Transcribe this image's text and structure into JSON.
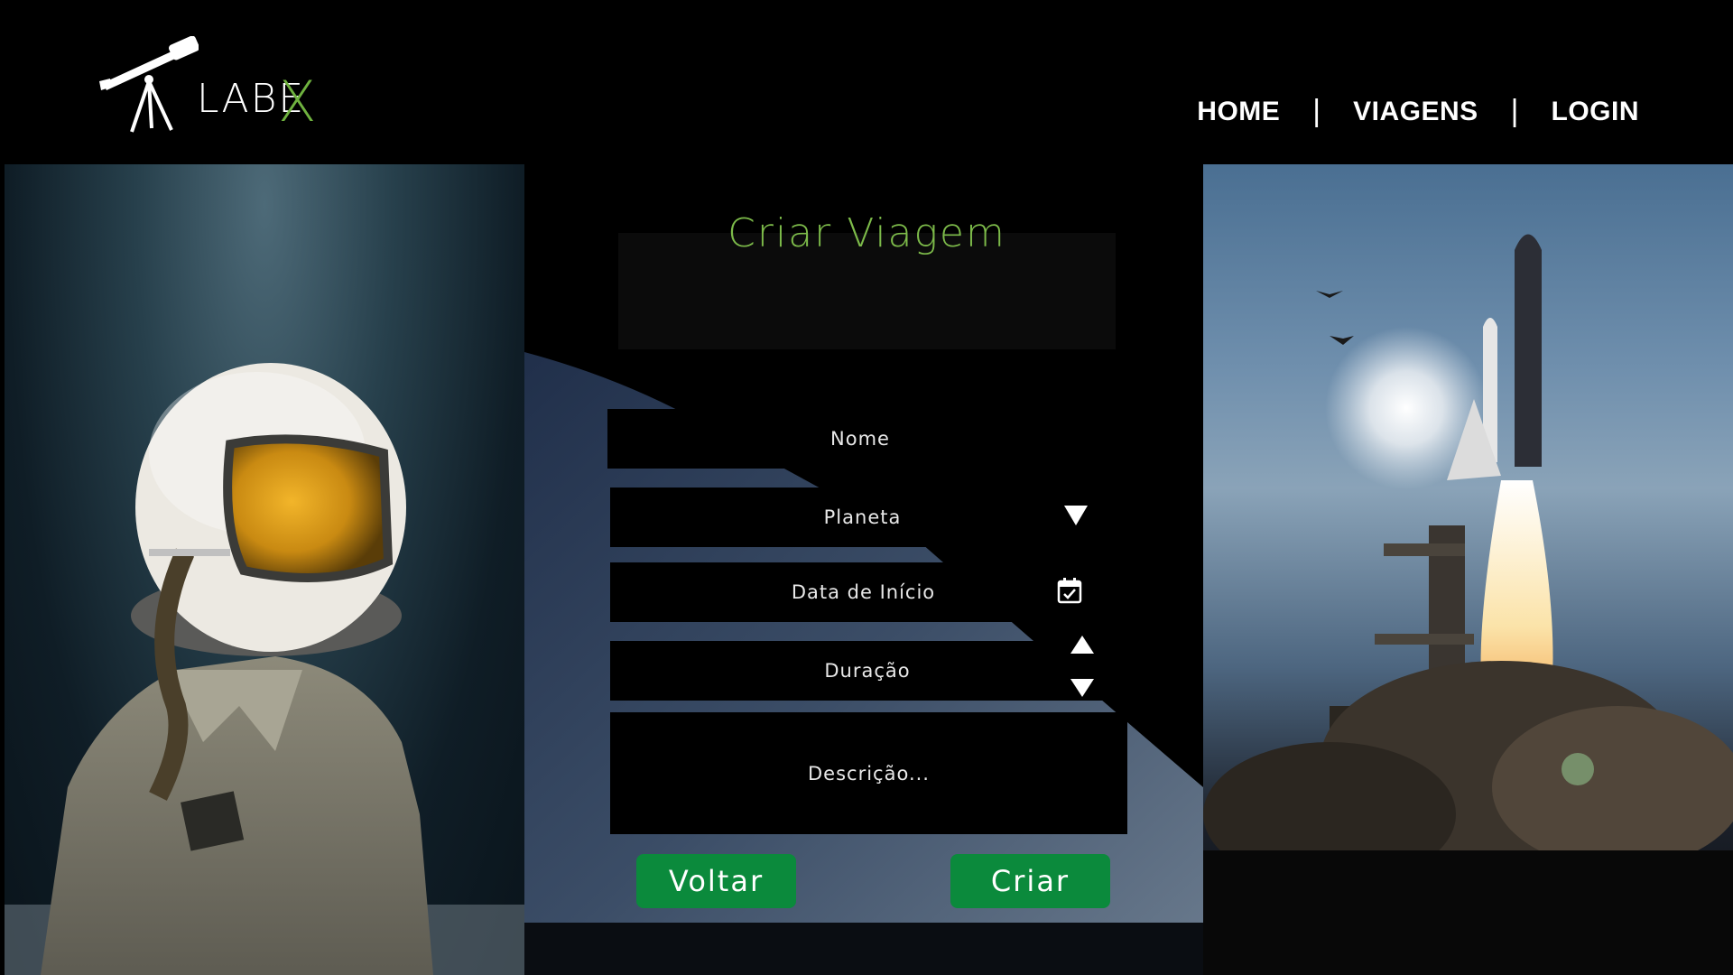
{
  "header": {
    "logo_text": "LABE",
    "logo_accent": "X",
    "nav": [
      {
        "label": "HOME"
      },
      {
        "label": "VIAGENS"
      },
      {
        "label": "LOGIN"
      }
    ],
    "separator": "|"
  },
  "form": {
    "title": "Criar Viagem",
    "fields": {
      "name_placeholder": "Nome",
      "planet_placeholder": "Planeta",
      "start_date_placeholder": "Data de Início",
      "duration_placeholder": "Duração",
      "description_placeholder": "Descrição..."
    },
    "buttons": {
      "back": "Voltar",
      "create": "Criar"
    }
  },
  "icons": {
    "planet": "chevron-down-icon",
    "date": "calendar-icon",
    "duration_up": "arrow-up-icon",
    "duration_down": "arrow-down-icon"
  },
  "colors": {
    "accent_green": "#7dbb4a",
    "button_green": "#0b8a3c",
    "background": "#000000"
  }
}
